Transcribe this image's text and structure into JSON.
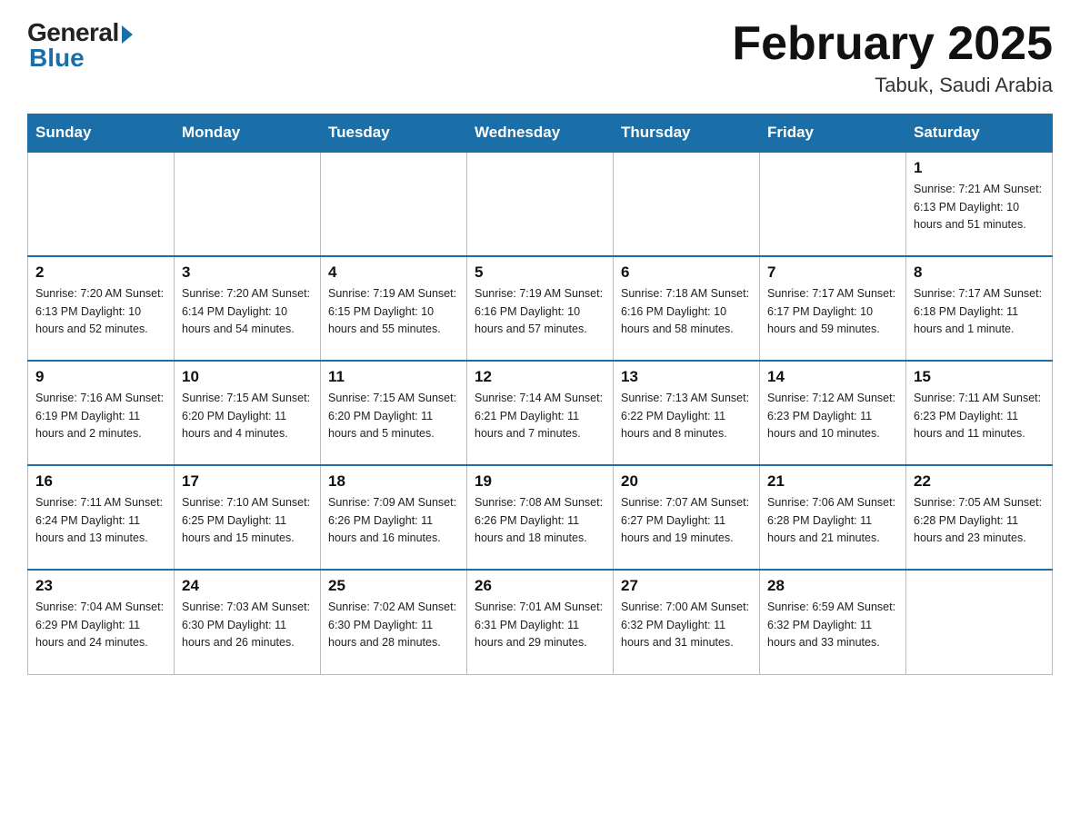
{
  "header": {
    "logo_general": "General",
    "logo_blue": "Blue",
    "title": "February 2025",
    "location": "Tabuk, Saudi Arabia"
  },
  "days_of_week": [
    "Sunday",
    "Monday",
    "Tuesday",
    "Wednesday",
    "Thursday",
    "Friday",
    "Saturday"
  ],
  "weeks": [
    [
      {
        "day": "",
        "info": ""
      },
      {
        "day": "",
        "info": ""
      },
      {
        "day": "",
        "info": ""
      },
      {
        "day": "",
        "info": ""
      },
      {
        "day": "",
        "info": ""
      },
      {
        "day": "",
        "info": ""
      },
      {
        "day": "1",
        "info": "Sunrise: 7:21 AM\nSunset: 6:13 PM\nDaylight: 10 hours\nand 51 minutes."
      }
    ],
    [
      {
        "day": "2",
        "info": "Sunrise: 7:20 AM\nSunset: 6:13 PM\nDaylight: 10 hours\nand 52 minutes."
      },
      {
        "day": "3",
        "info": "Sunrise: 7:20 AM\nSunset: 6:14 PM\nDaylight: 10 hours\nand 54 minutes."
      },
      {
        "day": "4",
        "info": "Sunrise: 7:19 AM\nSunset: 6:15 PM\nDaylight: 10 hours\nand 55 minutes."
      },
      {
        "day": "5",
        "info": "Sunrise: 7:19 AM\nSunset: 6:16 PM\nDaylight: 10 hours\nand 57 minutes."
      },
      {
        "day": "6",
        "info": "Sunrise: 7:18 AM\nSunset: 6:16 PM\nDaylight: 10 hours\nand 58 minutes."
      },
      {
        "day": "7",
        "info": "Sunrise: 7:17 AM\nSunset: 6:17 PM\nDaylight: 10 hours\nand 59 minutes."
      },
      {
        "day": "8",
        "info": "Sunrise: 7:17 AM\nSunset: 6:18 PM\nDaylight: 11 hours\nand 1 minute."
      }
    ],
    [
      {
        "day": "9",
        "info": "Sunrise: 7:16 AM\nSunset: 6:19 PM\nDaylight: 11 hours\nand 2 minutes."
      },
      {
        "day": "10",
        "info": "Sunrise: 7:15 AM\nSunset: 6:20 PM\nDaylight: 11 hours\nand 4 minutes."
      },
      {
        "day": "11",
        "info": "Sunrise: 7:15 AM\nSunset: 6:20 PM\nDaylight: 11 hours\nand 5 minutes."
      },
      {
        "day": "12",
        "info": "Sunrise: 7:14 AM\nSunset: 6:21 PM\nDaylight: 11 hours\nand 7 minutes."
      },
      {
        "day": "13",
        "info": "Sunrise: 7:13 AM\nSunset: 6:22 PM\nDaylight: 11 hours\nand 8 minutes."
      },
      {
        "day": "14",
        "info": "Sunrise: 7:12 AM\nSunset: 6:23 PM\nDaylight: 11 hours\nand 10 minutes."
      },
      {
        "day": "15",
        "info": "Sunrise: 7:11 AM\nSunset: 6:23 PM\nDaylight: 11 hours\nand 11 minutes."
      }
    ],
    [
      {
        "day": "16",
        "info": "Sunrise: 7:11 AM\nSunset: 6:24 PM\nDaylight: 11 hours\nand 13 minutes."
      },
      {
        "day": "17",
        "info": "Sunrise: 7:10 AM\nSunset: 6:25 PM\nDaylight: 11 hours\nand 15 minutes."
      },
      {
        "day": "18",
        "info": "Sunrise: 7:09 AM\nSunset: 6:26 PM\nDaylight: 11 hours\nand 16 minutes."
      },
      {
        "day": "19",
        "info": "Sunrise: 7:08 AM\nSunset: 6:26 PM\nDaylight: 11 hours\nand 18 minutes."
      },
      {
        "day": "20",
        "info": "Sunrise: 7:07 AM\nSunset: 6:27 PM\nDaylight: 11 hours\nand 19 minutes."
      },
      {
        "day": "21",
        "info": "Sunrise: 7:06 AM\nSunset: 6:28 PM\nDaylight: 11 hours\nand 21 minutes."
      },
      {
        "day": "22",
        "info": "Sunrise: 7:05 AM\nSunset: 6:28 PM\nDaylight: 11 hours\nand 23 minutes."
      }
    ],
    [
      {
        "day": "23",
        "info": "Sunrise: 7:04 AM\nSunset: 6:29 PM\nDaylight: 11 hours\nand 24 minutes."
      },
      {
        "day": "24",
        "info": "Sunrise: 7:03 AM\nSunset: 6:30 PM\nDaylight: 11 hours\nand 26 minutes."
      },
      {
        "day": "25",
        "info": "Sunrise: 7:02 AM\nSunset: 6:30 PM\nDaylight: 11 hours\nand 28 minutes."
      },
      {
        "day": "26",
        "info": "Sunrise: 7:01 AM\nSunset: 6:31 PM\nDaylight: 11 hours\nand 29 minutes."
      },
      {
        "day": "27",
        "info": "Sunrise: 7:00 AM\nSunset: 6:32 PM\nDaylight: 11 hours\nand 31 minutes."
      },
      {
        "day": "28",
        "info": "Sunrise: 6:59 AM\nSunset: 6:32 PM\nDaylight: 11 hours\nand 33 minutes."
      },
      {
        "day": "",
        "info": ""
      }
    ]
  ]
}
